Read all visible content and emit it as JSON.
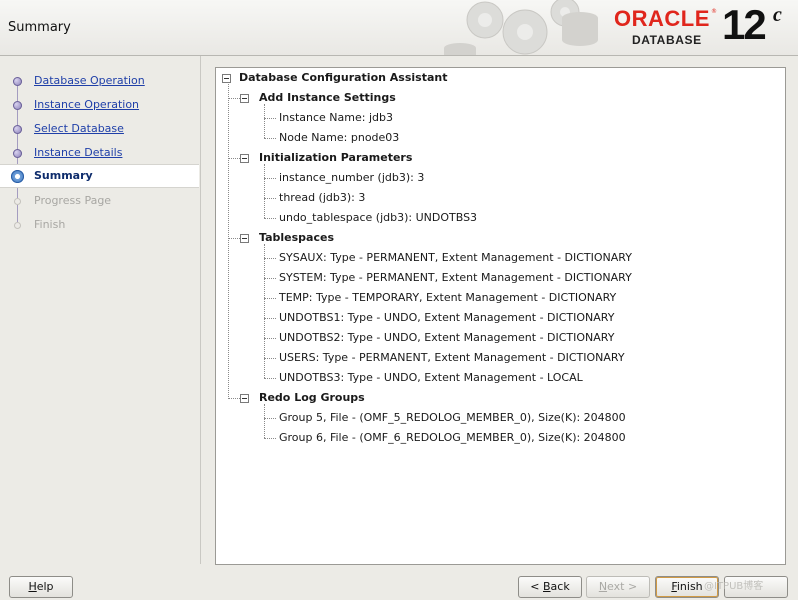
{
  "header": {
    "title": "Summary",
    "brand": "ORACLE",
    "product": "DATABASE",
    "version": "12",
    "version_suffix": "c",
    "brand_color": "#e0261c"
  },
  "nav": {
    "items": [
      {
        "label": "Database Operation",
        "state": "done"
      },
      {
        "label": "Instance Operation",
        "state": "done"
      },
      {
        "label": "Select Database",
        "state": "done"
      },
      {
        "label": "Instance Details",
        "state": "done"
      },
      {
        "label": "Summary",
        "state": "current"
      },
      {
        "label": "Progress Page",
        "state": "pending"
      },
      {
        "label": "Finish",
        "state": "pending"
      }
    ]
  },
  "tree": {
    "root": "Database Configuration Assistant",
    "sections": [
      {
        "label": "Add Instance Settings",
        "items": [
          "Instance Name: jdb3",
          "Node Name: pnode03"
        ]
      },
      {
        "label": "Initialization Parameters",
        "items": [
          "instance_number (jdb3): 3",
          "thread (jdb3): 3",
          "undo_tablespace (jdb3): UNDOTBS3"
        ]
      },
      {
        "label": "Tablespaces",
        "items": [
          "SYSAUX: Type - PERMANENT, Extent Management - DICTIONARY",
          "SYSTEM: Type - PERMANENT, Extent Management - DICTIONARY",
          "TEMP: Type - TEMPORARY, Extent Management - DICTIONARY",
          "UNDOTBS1: Type - UNDO, Extent Management - DICTIONARY",
          "UNDOTBS2: Type - UNDO, Extent Management - DICTIONARY",
          "USERS: Type - PERMANENT, Extent Management - DICTIONARY",
          "UNDOTBS3: Type - UNDO, Extent Management - LOCAL"
        ]
      },
      {
        "label": "Redo Log Groups",
        "items": [
          "Group 5, File - (OMF_5_REDOLOG_MEMBER_0), Size(K): 204800",
          "Group 6, File - (OMF_6_REDOLOG_MEMBER_0), Size(K): 204800"
        ]
      }
    ]
  },
  "buttons": {
    "help": {
      "mnemonic": "H",
      "rest": "elp"
    },
    "back": {
      "prefix": "< ",
      "mnemonic": "B",
      "rest": "ack"
    },
    "next": {
      "mnemonic": "N",
      "rest": "ext >"
    },
    "finish": {
      "mnemonic": "F",
      "rest": "inish"
    }
  },
  "watermark": "@ITPUB博客"
}
